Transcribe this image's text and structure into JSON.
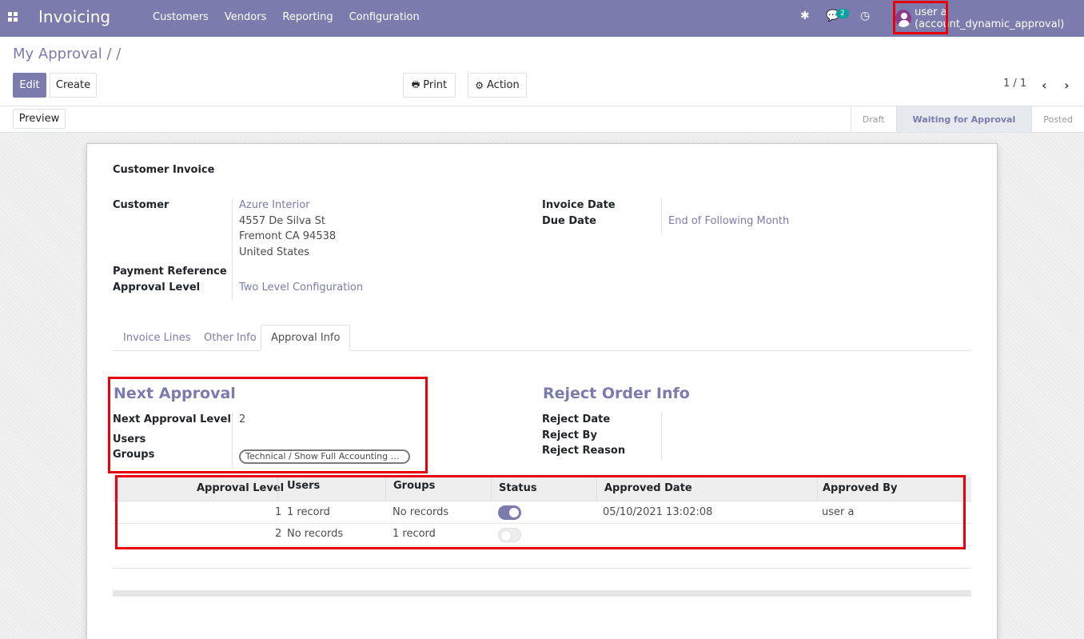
{
  "navbar": {
    "app_title": "Invoicing",
    "menu": [
      "Customers",
      "Vendors",
      "Reporting",
      "Configuration"
    ],
    "icons": [
      "apps-icon",
      "bug-icon",
      "chat-icon",
      "clock-icon"
    ],
    "message_count": "2",
    "user": "user a (account_dynamic_approval)",
    "color": "#7c7bad"
  },
  "control": {
    "breadcrumb": "My Approval / /",
    "edit": "Edit",
    "create": "Create",
    "print": "Print",
    "action": "Action",
    "pager": "1 / 1",
    "preview": "Preview"
  },
  "status": {
    "steps": [
      "Draft",
      "Waiting for Approval",
      "Posted"
    ],
    "active": "Waiting for Approval"
  },
  "form": {
    "doc_type": "Customer Invoice",
    "customer_label": "Customer",
    "customer_name": "Azure Interior",
    "address": [
      "4557 De Silva St",
      "Fremont CA 94538",
      "United States"
    ],
    "payment_ref_label": "Payment Reference",
    "approval_level_label": "Approval Level",
    "approval_level_value": "Two Level Configuration",
    "invoice_date_label": "Invoice Date",
    "due_date_label": "Due Date",
    "due_date_value": "End of Following Month"
  },
  "tabs": [
    "Invoice Lines",
    "Other Info",
    "Approval Info"
  ],
  "active_tab": "Approval Info",
  "next_approval": {
    "title": "Next Approval",
    "level_label": "Next Approval Level",
    "level_value": "2",
    "users_label": "Users",
    "groups_label": "Groups",
    "group_tag": "Technical / Show Full Accounting Features"
  },
  "reject": {
    "title": "Reject Order Info",
    "date_label": "Reject Date",
    "by_label": "Reject By",
    "reason_label": "Reject Reason"
  },
  "approval_table": {
    "headers": [
      "Approval Level",
      "Users",
      "Groups",
      "Status",
      "Approved Date",
      "Approved By"
    ],
    "rows": [
      {
        "level": "1",
        "users": "1 record",
        "groups": "No records",
        "status": true,
        "date": "05/10/2021 13:02:08",
        "by": "user a"
      },
      {
        "level": "2",
        "users": "No records",
        "groups": "1 record",
        "status": false,
        "date": "",
        "by": ""
      }
    ]
  }
}
